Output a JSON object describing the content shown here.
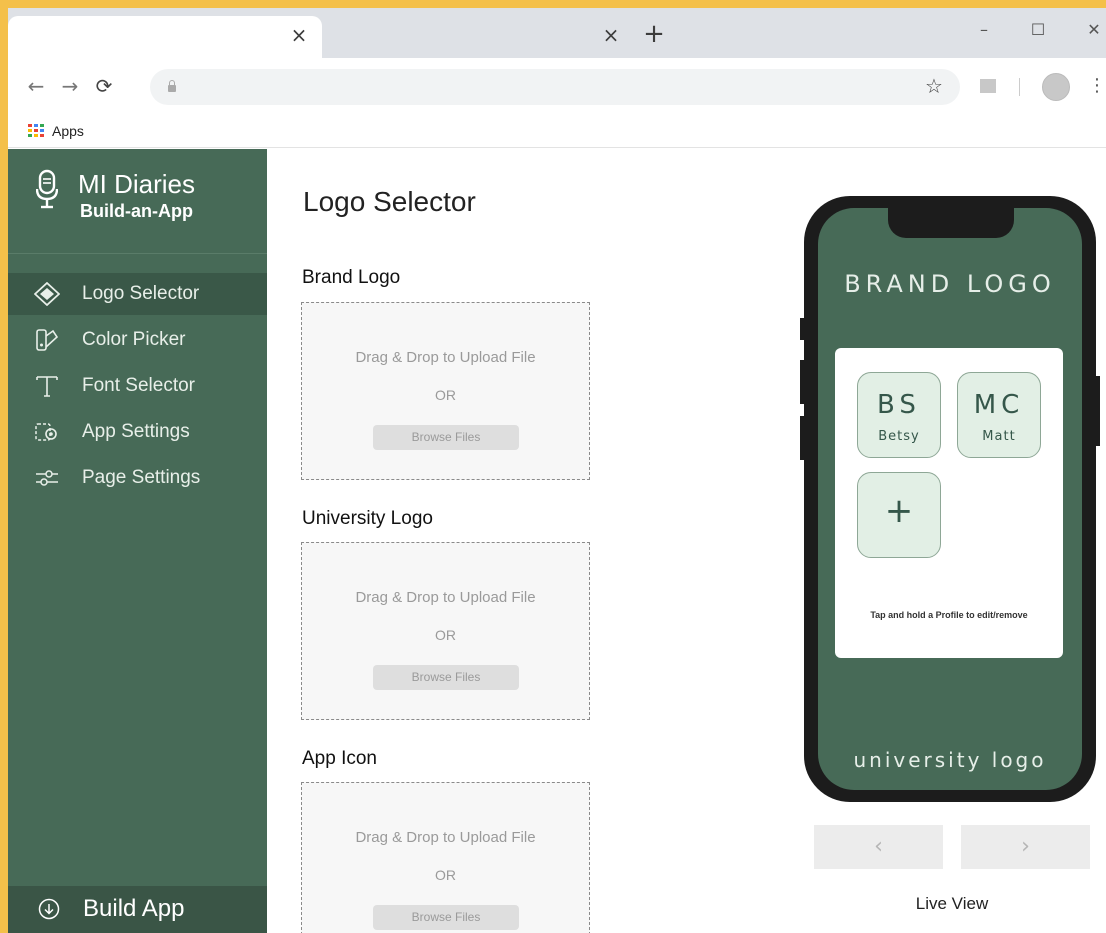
{
  "browser": {
    "tabs": [
      {
        "title": "",
        "close_icon": "×"
      },
      {
        "title": "",
        "close_icon": "×"
      }
    ],
    "new_tab_icon": "+",
    "window_controls": {
      "minimize": "–",
      "maximize": "☐",
      "close": "✕"
    },
    "nav": {
      "back": "←",
      "forward": "→",
      "reload": "⟳"
    },
    "address": "",
    "star_icon": "☆",
    "menu_icon": "⋮",
    "bookmarks": {
      "apps_label": "Apps"
    }
  },
  "sidebar": {
    "brand_title": "MI Diaries",
    "brand_subtitle": "Build-an-App",
    "items": [
      {
        "label": "Logo Selector",
        "icon": "logo-diamond-icon",
        "active": true
      },
      {
        "label": "Color Picker",
        "icon": "color-palette-icon",
        "active": false
      },
      {
        "label": "Font Selector",
        "icon": "font-text-icon",
        "active": false
      },
      {
        "label": "App Settings",
        "icon": "gear-settings-icon",
        "active": false
      },
      {
        "label": "Page Settings",
        "icon": "sliders-icon",
        "active": false
      }
    ],
    "build_label": "Build App"
  },
  "main": {
    "title": "Logo Selector",
    "sections": [
      {
        "label": "Brand Logo",
        "drop_text": "Drag & Drop to Upload File",
        "or_text": "OR",
        "button": "Browse Files"
      },
      {
        "label": "University Logo",
        "drop_text": "Drag & Drop to Upload File",
        "or_text": "OR",
        "button": "Browse Files"
      },
      {
        "label": "App Icon",
        "drop_text": "Drag & Drop to Upload File",
        "or_text": "OR",
        "button": "Browse Files"
      }
    ]
  },
  "preview": {
    "brand_logo": "BRAND LOGO",
    "university_logo": "university logo",
    "profiles": [
      {
        "initials": "BS",
        "name": "Betsy"
      },
      {
        "initials": "MC",
        "name": "Matt"
      }
    ],
    "add_profile": "+",
    "hint": "Tap and hold a Profile to edit/remove",
    "prev_icon": "‹",
    "next_icon": "›",
    "caption": "Live View"
  },
  "colors": {
    "sidebar_bg": "#476a57",
    "sidebar_active": "#3a5848",
    "phone_screen": "#476a57",
    "profile_tile": "#e2efe5"
  }
}
